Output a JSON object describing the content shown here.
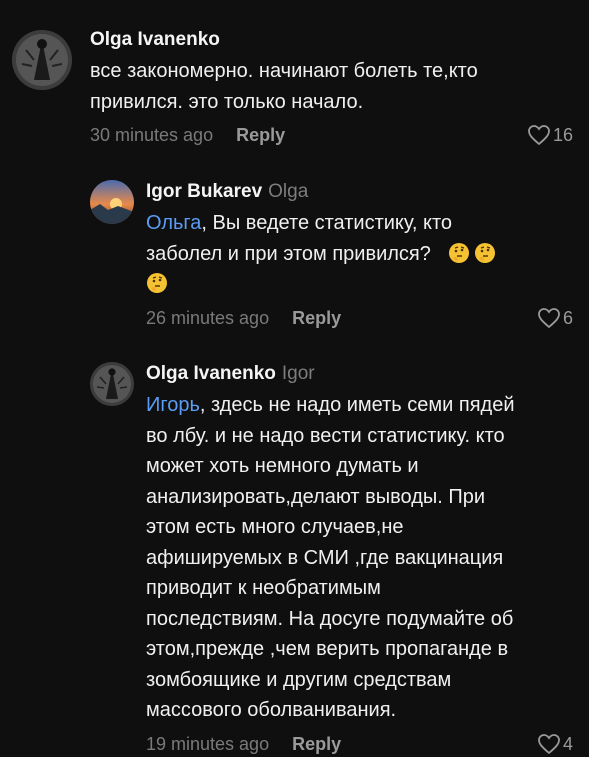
{
  "comments": [
    {
      "author": "Olga Ivanenko",
      "reply_to": "",
      "mention": "",
      "text_lines": [
        "все закономерно. начинают болеть те,кто",
        "привился. это только начало."
      ],
      "time": "30 minutes ago",
      "reply_label": "Reply",
      "likes": "16",
      "avatar": "dark-figure-avatar"
    },
    {
      "author": "Igor Bukarev",
      "reply_to": "Olga",
      "mention": "Ольга",
      "text_lines": [
        ", Вы ведете статистику, кто",
        "заболел и при этом привился?"
      ],
      "emojis": [
        "thinking-face-emoji",
        "thinking-face-emoji",
        "thinking-face-emoji"
      ],
      "time": "26 minutes ago",
      "reply_label": "Reply",
      "likes": "6",
      "avatar": "sunset-landscape-avatar"
    },
    {
      "author": "Olga Ivanenko",
      "reply_to": "Igor",
      "mention": "Игорь",
      "text_lines": [
        ", здесь не надо иметь семи пядей",
        "во лбу. и не надо вести статистику. кто",
        "может хоть немного думать и",
        "анализировать,делают выводы. При",
        "этом есть много случаев,не",
        "афишируемых в СМИ ,где вакцинация",
        "приводит к необратимым",
        "последствиям. На досуге подумайте об",
        "этом,прежде ,чем верить пропаганде в",
        "зомбоящике и другим средствам",
        "массового оболванивания."
      ],
      "time": "19 minutes ago",
      "reply_label": "Reply",
      "likes": "4",
      "avatar": "dark-figure-avatar"
    }
  ],
  "colors": {
    "background": "#0f0f0f",
    "mention": "#5b9cf5",
    "muted": "#7a7a7a"
  }
}
